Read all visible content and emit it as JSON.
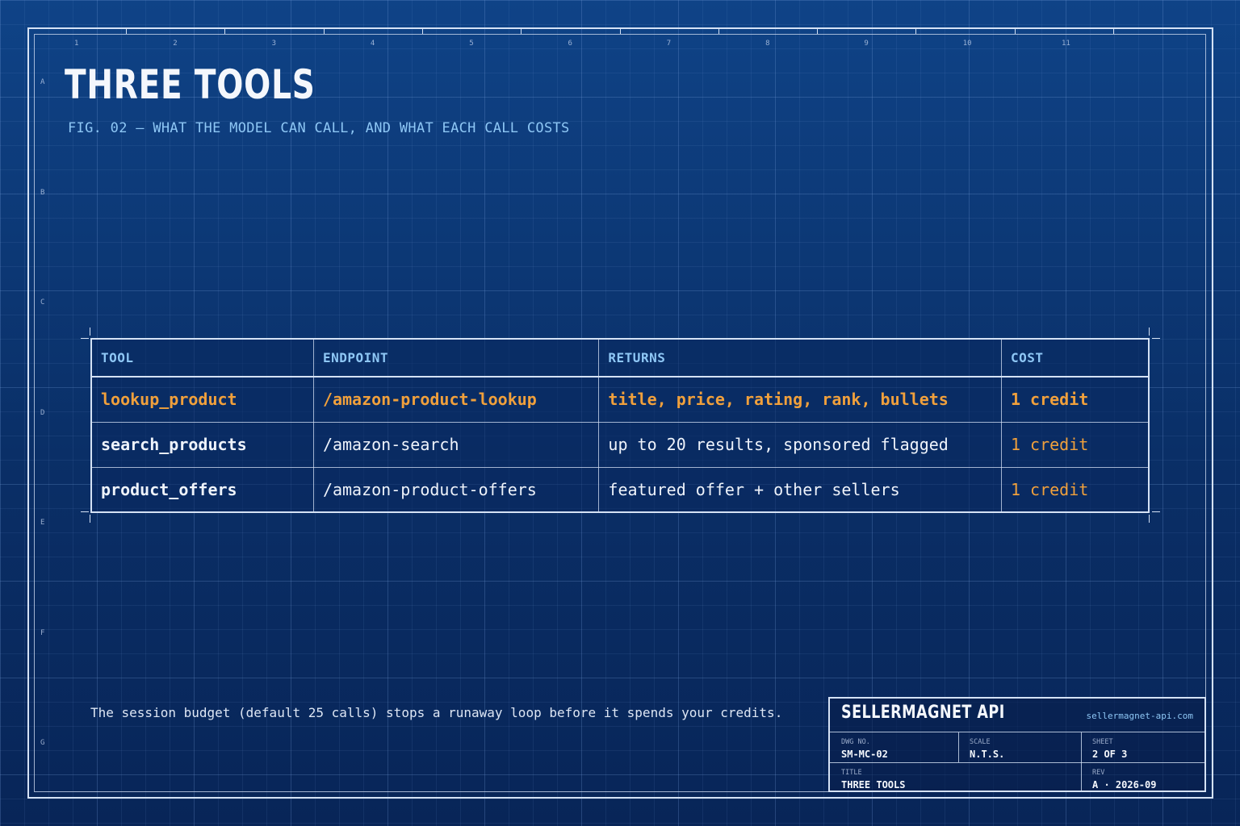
{
  "header": {
    "title": "THREE TOOLS",
    "subtitle": "FIG. 02  —  WHAT THE MODEL CAN CALL, AND WHAT EACH CALL COSTS"
  },
  "grid": {
    "columns": [
      "1",
      "2",
      "3",
      "4",
      "5",
      "6",
      "7",
      "8",
      "9",
      "10",
      "11"
    ],
    "rows": [
      "A",
      "B",
      "C",
      "D",
      "E",
      "F",
      "G"
    ]
  },
  "table": {
    "headers": [
      "TOOL",
      "ENDPOINT",
      "RETURNS",
      "COST"
    ],
    "rows": [
      {
        "tool": "lookup_product",
        "endpoint": "/amazon-product-lookup",
        "returns": "title, price, rating, rank, bullets",
        "cost": "1 credit",
        "highlighted": true
      },
      {
        "tool": "search_products",
        "endpoint": "/amazon-search",
        "returns": "up to 20 results, sponsored flagged",
        "cost": "1 credit",
        "highlighted": false
      },
      {
        "tool": "product_offers",
        "endpoint": "/amazon-product-offers",
        "returns": "featured offer + other sellers",
        "cost": "1 credit",
        "highlighted": false
      }
    ]
  },
  "note": "The session budget (default 25 calls) stops a runaway loop before it spends your credits.",
  "title_block": {
    "brand": "SELLERMAGNET API",
    "url": "sellermagnet-api.com",
    "dwg_no_label": "DWG NO.",
    "dwg_no": "SM-MC-02",
    "scale_label": "SCALE",
    "scale": "N.T.S.",
    "sheet_label": "SHEET",
    "sheet": "2 OF 3",
    "title_label": "TITLE",
    "title": "THREE TOOLS",
    "rev_label": "REV",
    "rev": "A · 2026-09"
  },
  "colors": {
    "accent": "#f0a03c",
    "header_text": "#8ec7f5",
    "line": "#d5e2f5",
    "background": "#0c3574"
  }
}
